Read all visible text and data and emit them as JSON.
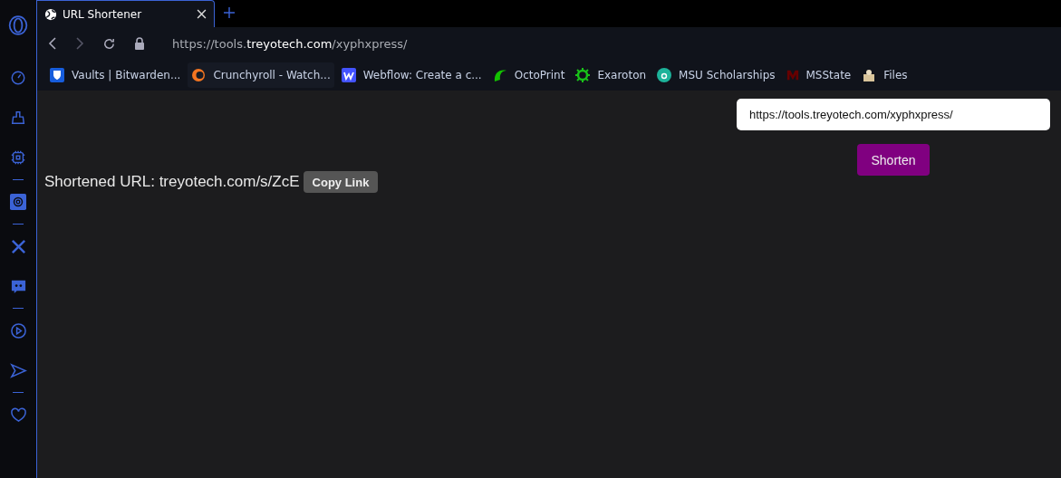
{
  "tab": {
    "title": "URL Shortener",
    "selected": true
  },
  "address": {
    "prefix": "https://tools.",
    "host": "treyotech.com",
    "path": "/xyphxpress/"
  },
  "bookmarks": [
    {
      "label": "Vaults | Bitwarden..."
    },
    {
      "label": "Crunchyroll - Watch..."
    },
    {
      "label": "Webflow: Create a c..."
    },
    {
      "label": "OctoPrint"
    },
    {
      "label": "Exaroton"
    },
    {
      "label": "MSU Scholarships"
    },
    {
      "label": "MSState"
    },
    {
      "label": "Files"
    }
  ],
  "form": {
    "url_value": "https://tools.treyotech.com/xyphxpress/",
    "submit": "Shorten"
  },
  "result": {
    "text": "Shortened URL: treyotech.com/s/ZcE",
    "copy": "Copy Link"
  }
}
